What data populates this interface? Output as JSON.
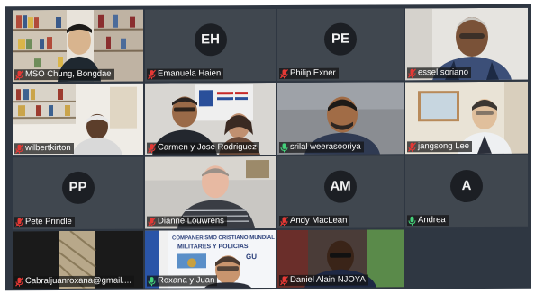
{
  "colors": {
    "muted_mic": "#e53935",
    "active_mic": "#43d17a",
    "avatar_bg": "#1c1f24",
    "tile_bg": "#3a414c"
  },
  "participants": [
    {
      "name": "MSO Chung, Bongdae",
      "mic": "muted-mic-icon"
    },
    {
      "name": "Emanuela Haien",
      "initials": "EH",
      "mic": "muted-mic-icon"
    },
    {
      "name": "Philip Exner",
      "initials": "PE",
      "mic": "muted-mic-icon"
    },
    {
      "name": "essel soriano",
      "mic": "muted-mic-icon"
    },
    {
      "name": "wilbertkirton",
      "mic": "muted-mic-icon"
    },
    {
      "name": "Carmen y Jose Rodriguez",
      "mic": "muted-mic-icon"
    },
    {
      "name": "srilal weerasooriya",
      "mic": "active-mic-icon"
    },
    {
      "name": "jangsong Lee",
      "mic": "muted-mic-icon"
    },
    {
      "name": "Pete Prindle",
      "initials": "PP",
      "mic": "muted-mic-icon"
    },
    {
      "name": "Dianne Louwrens",
      "mic": "muted-mic-icon"
    },
    {
      "name": "Andy MacLean",
      "initials": "AM",
      "mic": "muted-mic-icon"
    },
    {
      "name": "Andrea",
      "initials": "A",
      "mic": "active-mic-icon"
    },
    {
      "name": "Cabraljuanroxana@gmail....",
      "mic": "muted-mic-icon"
    },
    {
      "name": "Roxana y Juan",
      "mic": "active-mic-icon"
    },
    {
      "name": "Daniel Alain NJOYA",
      "mic": "muted-mic-icon"
    }
  ],
  "banner": {
    "line1": "COMPANERISMO CRISTIANO MUNDIAL",
    "line2": "MILITARES Y POLICIAS",
    "line3": "GU"
  }
}
